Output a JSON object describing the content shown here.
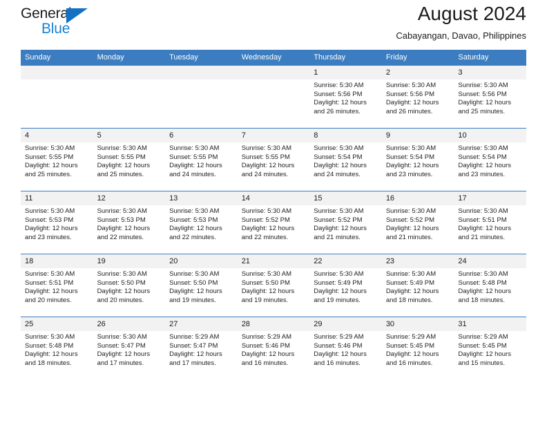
{
  "brand": {
    "name_top": "General",
    "name_bottom": "Blue",
    "accent_color": "#1b82d2",
    "triangle_color": "#1271c4"
  },
  "header": {
    "title": "August 2024",
    "subtitle": "Cabayangan, Davao, Philippines"
  },
  "calendar": {
    "header_bg": "#3b7dc0",
    "daynum_bg": "#f2f2f2",
    "weekday_headers": [
      "Sunday",
      "Monday",
      "Tuesday",
      "Wednesday",
      "Thursday",
      "Friday",
      "Saturday"
    ],
    "weeks": [
      [
        {
          "day": "",
          "sunrise": "",
          "sunset": "",
          "daylight": "",
          "daylight2": ""
        },
        {
          "day": "",
          "sunrise": "",
          "sunset": "",
          "daylight": "",
          "daylight2": ""
        },
        {
          "day": "",
          "sunrise": "",
          "sunset": "",
          "daylight": "",
          "daylight2": ""
        },
        {
          "day": "",
          "sunrise": "",
          "sunset": "",
          "daylight": "",
          "daylight2": ""
        },
        {
          "day": "1",
          "sunrise": "Sunrise: 5:30 AM",
          "sunset": "Sunset: 5:56 PM",
          "daylight": "Daylight: 12 hours",
          "daylight2": "and 26 minutes."
        },
        {
          "day": "2",
          "sunrise": "Sunrise: 5:30 AM",
          "sunset": "Sunset: 5:56 PM",
          "daylight": "Daylight: 12 hours",
          "daylight2": "and 26 minutes."
        },
        {
          "day": "3",
          "sunrise": "Sunrise: 5:30 AM",
          "sunset": "Sunset: 5:56 PM",
          "daylight": "Daylight: 12 hours",
          "daylight2": "and 25 minutes."
        }
      ],
      [
        {
          "day": "4",
          "sunrise": "Sunrise: 5:30 AM",
          "sunset": "Sunset: 5:55 PM",
          "daylight": "Daylight: 12 hours",
          "daylight2": "and 25 minutes."
        },
        {
          "day": "5",
          "sunrise": "Sunrise: 5:30 AM",
          "sunset": "Sunset: 5:55 PM",
          "daylight": "Daylight: 12 hours",
          "daylight2": "and 25 minutes."
        },
        {
          "day": "6",
          "sunrise": "Sunrise: 5:30 AM",
          "sunset": "Sunset: 5:55 PM",
          "daylight": "Daylight: 12 hours",
          "daylight2": "and 24 minutes."
        },
        {
          "day": "7",
          "sunrise": "Sunrise: 5:30 AM",
          "sunset": "Sunset: 5:55 PM",
          "daylight": "Daylight: 12 hours",
          "daylight2": "and 24 minutes."
        },
        {
          "day": "8",
          "sunrise": "Sunrise: 5:30 AM",
          "sunset": "Sunset: 5:54 PM",
          "daylight": "Daylight: 12 hours",
          "daylight2": "and 24 minutes."
        },
        {
          "day": "9",
          "sunrise": "Sunrise: 5:30 AM",
          "sunset": "Sunset: 5:54 PM",
          "daylight": "Daylight: 12 hours",
          "daylight2": "and 23 minutes."
        },
        {
          "day": "10",
          "sunrise": "Sunrise: 5:30 AM",
          "sunset": "Sunset: 5:54 PM",
          "daylight": "Daylight: 12 hours",
          "daylight2": "and 23 minutes."
        }
      ],
      [
        {
          "day": "11",
          "sunrise": "Sunrise: 5:30 AM",
          "sunset": "Sunset: 5:53 PM",
          "daylight": "Daylight: 12 hours",
          "daylight2": "and 23 minutes."
        },
        {
          "day": "12",
          "sunrise": "Sunrise: 5:30 AM",
          "sunset": "Sunset: 5:53 PM",
          "daylight": "Daylight: 12 hours",
          "daylight2": "and 22 minutes."
        },
        {
          "day": "13",
          "sunrise": "Sunrise: 5:30 AM",
          "sunset": "Sunset: 5:53 PM",
          "daylight": "Daylight: 12 hours",
          "daylight2": "and 22 minutes."
        },
        {
          "day": "14",
          "sunrise": "Sunrise: 5:30 AM",
          "sunset": "Sunset: 5:52 PM",
          "daylight": "Daylight: 12 hours",
          "daylight2": "and 22 minutes."
        },
        {
          "day": "15",
          "sunrise": "Sunrise: 5:30 AM",
          "sunset": "Sunset: 5:52 PM",
          "daylight": "Daylight: 12 hours",
          "daylight2": "and 21 minutes."
        },
        {
          "day": "16",
          "sunrise": "Sunrise: 5:30 AM",
          "sunset": "Sunset: 5:52 PM",
          "daylight": "Daylight: 12 hours",
          "daylight2": "and 21 minutes."
        },
        {
          "day": "17",
          "sunrise": "Sunrise: 5:30 AM",
          "sunset": "Sunset: 5:51 PM",
          "daylight": "Daylight: 12 hours",
          "daylight2": "and 21 minutes."
        }
      ],
      [
        {
          "day": "18",
          "sunrise": "Sunrise: 5:30 AM",
          "sunset": "Sunset: 5:51 PM",
          "daylight": "Daylight: 12 hours",
          "daylight2": "and 20 minutes."
        },
        {
          "day": "19",
          "sunrise": "Sunrise: 5:30 AM",
          "sunset": "Sunset: 5:50 PM",
          "daylight": "Daylight: 12 hours",
          "daylight2": "and 20 minutes."
        },
        {
          "day": "20",
          "sunrise": "Sunrise: 5:30 AM",
          "sunset": "Sunset: 5:50 PM",
          "daylight": "Daylight: 12 hours",
          "daylight2": "and 19 minutes."
        },
        {
          "day": "21",
          "sunrise": "Sunrise: 5:30 AM",
          "sunset": "Sunset: 5:50 PM",
          "daylight": "Daylight: 12 hours",
          "daylight2": "and 19 minutes."
        },
        {
          "day": "22",
          "sunrise": "Sunrise: 5:30 AM",
          "sunset": "Sunset: 5:49 PM",
          "daylight": "Daylight: 12 hours",
          "daylight2": "and 19 minutes."
        },
        {
          "day": "23",
          "sunrise": "Sunrise: 5:30 AM",
          "sunset": "Sunset: 5:49 PM",
          "daylight": "Daylight: 12 hours",
          "daylight2": "and 18 minutes."
        },
        {
          "day": "24",
          "sunrise": "Sunrise: 5:30 AM",
          "sunset": "Sunset: 5:48 PM",
          "daylight": "Daylight: 12 hours",
          "daylight2": "and 18 minutes."
        }
      ],
      [
        {
          "day": "25",
          "sunrise": "Sunrise: 5:30 AM",
          "sunset": "Sunset: 5:48 PM",
          "daylight": "Daylight: 12 hours",
          "daylight2": "and 18 minutes."
        },
        {
          "day": "26",
          "sunrise": "Sunrise: 5:30 AM",
          "sunset": "Sunset: 5:47 PM",
          "daylight": "Daylight: 12 hours",
          "daylight2": "and 17 minutes."
        },
        {
          "day": "27",
          "sunrise": "Sunrise: 5:29 AM",
          "sunset": "Sunset: 5:47 PM",
          "daylight": "Daylight: 12 hours",
          "daylight2": "and 17 minutes."
        },
        {
          "day": "28",
          "sunrise": "Sunrise: 5:29 AM",
          "sunset": "Sunset: 5:46 PM",
          "daylight": "Daylight: 12 hours",
          "daylight2": "and 16 minutes."
        },
        {
          "day": "29",
          "sunrise": "Sunrise: 5:29 AM",
          "sunset": "Sunset: 5:46 PM",
          "daylight": "Daylight: 12 hours",
          "daylight2": "and 16 minutes."
        },
        {
          "day": "30",
          "sunrise": "Sunrise: 5:29 AM",
          "sunset": "Sunset: 5:45 PM",
          "daylight": "Daylight: 12 hours",
          "daylight2": "and 16 minutes."
        },
        {
          "day": "31",
          "sunrise": "Sunrise: 5:29 AM",
          "sunset": "Sunset: 5:45 PM",
          "daylight": "Daylight: 12 hours",
          "daylight2": "and 15 minutes."
        }
      ]
    ]
  }
}
